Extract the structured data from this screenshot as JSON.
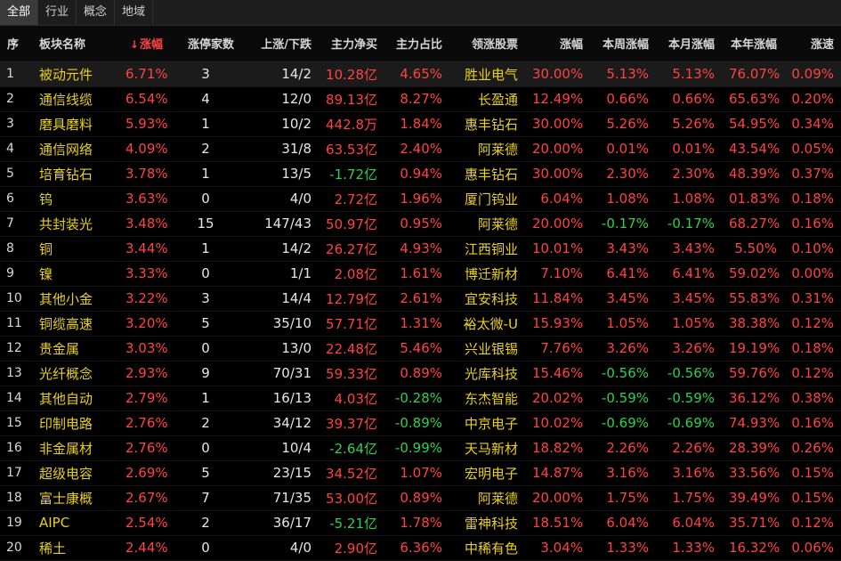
{
  "tabs": [
    "全部",
    "行业",
    "概念",
    "地域"
  ],
  "columns": {
    "idx": "序",
    "name": "板块名称",
    "sort_mark": "↓",
    "change": "涨幅",
    "limit_up": "涨停家数",
    "up_down": "上涨/下跌",
    "net_inflow": "主力净买",
    "ratio": "主力占比",
    "leader": "领涨股票",
    "leader_change": "涨幅",
    "week": "本周涨幅",
    "month": "本月涨幅",
    "year": "本年涨幅",
    "speed": "涨速"
  },
  "rows": [
    {
      "idx": "1",
      "name": "被动元件",
      "change": "6.71%",
      "limit_up": "3",
      "up_down": "14/2",
      "net": "10.28亿",
      "ratio": "4.65%",
      "leader": "胜业电气",
      "lchg": "30.00%",
      "week": "5.13%",
      "month": "5.13%",
      "year": "76.07%",
      "speed": "0.09%"
    },
    {
      "idx": "2",
      "name": "通信线缆",
      "change": "6.54%",
      "limit_up": "4",
      "up_down": "12/0",
      "net": "89.13亿",
      "ratio": "8.27%",
      "leader": "长盈通",
      "lchg": "12.49%",
      "week": "0.66%",
      "month": "0.66%",
      "year": "65.63%",
      "speed": "0.20%"
    },
    {
      "idx": "3",
      "name": "磨具磨料",
      "change": "5.93%",
      "limit_up": "1",
      "up_down": "10/2",
      "net": "442.8万",
      "ratio": "1.84%",
      "leader": "惠丰钻石",
      "lchg": "30.00%",
      "week": "5.26%",
      "month": "5.26%",
      "year": "54.95%",
      "speed": "0.34%"
    },
    {
      "idx": "4",
      "name": "通信网络",
      "change": "4.09%",
      "limit_up": "2",
      "up_down": "31/8",
      "net": "63.53亿",
      "ratio": "2.40%",
      "leader": "阿莱德",
      "lchg": "20.00%",
      "week": "0.01%",
      "month": "0.01%",
      "year": "43.54%",
      "speed": "0.05%"
    },
    {
      "idx": "5",
      "name": "培育钻石",
      "change": "3.78%",
      "limit_up": "1",
      "up_down": "13/5",
      "net": "-1.72亿",
      "ratio": "0.94%",
      "leader": "惠丰钻石",
      "lchg": "30.00%",
      "week": "2.30%",
      "month": "2.30%",
      "year": "48.39%",
      "speed": "0.37%"
    },
    {
      "idx": "6",
      "name": "钨",
      "change": "3.63%",
      "limit_up": "0",
      "up_down": "4/0",
      "net": "2.72亿",
      "ratio": "1.96%",
      "leader": "厦门钨业",
      "lchg": "6.04%",
      "week": "1.08%",
      "month": "1.08%",
      "year": "01.83%",
      "speed": "0.18%"
    },
    {
      "idx": "7",
      "name": "共封装光",
      "change": "3.48%",
      "limit_up": "15",
      "up_down": "147/43",
      "net": "50.97亿",
      "ratio": "0.95%",
      "leader": "阿莱德",
      "lchg": "20.00%",
      "week": "-0.17%",
      "month": "-0.17%",
      "year": "68.27%",
      "speed": "0.16%"
    },
    {
      "idx": "8",
      "name": "铜",
      "change": "3.44%",
      "limit_up": "1",
      "up_down": "14/2",
      "net": "26.27亿",
      "ratio": "4.93%",
      "leader": "江西铜业",
      "lchg": "10.01%",
      "week": "3.43%",
      "month": "3.43%",
      "year": "5.50%",
      "speed": "0.10%"
    },
    {
      "idx": "9",
      "name": "镍",
      "change": "3.33%",
      "limit_up": "0",
      "up_down": "1/1",
      "net": "2.08亿",
      "ratio": "1.61%",
      "leader": "博迁新材",
      "lchg": "7.10%",
      "week": "6.41%",
      "month": "6.41%",
      "year": "59.02%",
      "speed": "0.00%"
    },
    {
      "idx": "10",
      "name": "其他小金",
      "change": "3.22%",
      "limit_up": "3",
      "up_down": "14/4",
      "net": "12.79亿",
      "ratio": "2.61%",
      "leader": "宜安科技",
      "lchg": "11.84%",
      "week": "3.45%",
      "month": "3.45%",
      "year": "55.83%",
      "speed": "0.31%"
    },
    {
      "idx": "11",
      "name": "铜缆高速",
      "change": "3.20%",
      "limit_up": "5",
      "up_down": "35/10",
      "net": "57.71亿",
      "ratio": "1.31%",
      "leader": "裕太微-U",
      "lchg": "15.93%",
      "week": "1.05%",
      "month": "1.05%",
      "year": "38.38%",
      "speed": "0.12%"
    },
    {
      "idx": "12",
      "name": "贵金属",
      "change": "3.03%",
      "limit_up": "0",
      "up_down": "13/0",
      "net": "22.48亿",
      "ratio": "5.46%",
      "leader": "兴业银锡",
      "lchg": "7.76%",
      "week": "3.26%",
      "month": "3.26%",
      "year": "19.19%",
      "speed": "0.18%"
    },
    {
      "idx": "13",
      "name": "光纤概念",
      "change": "2.93%",
      "limit_up": "9",
      "up_down": "70/31",
      "net": "59.33亿",
      "ratio": "0.89%",
      "leader": "光库科技",
      "lchg": "15.46%",
      "week": "-0.56%",
      "month": "-0.56%",
      "year": "59.76%",
      "speed": "0.12%"
    },
    {
      "idx": "14",
      "name": "其他自动",
      "change": "2.79%",
      "limit_up": "1",
      "up_down": "16/13",
      "net": "4.03亿",
      "ratio": "-0.28%",
      "leader": "东杰智能",
      "lchg": "20.02%",
      "week": "-0.59%",
      "month": "-0.59%",
      "year": "36.12%",
      "speed": "0.38%"
    },
    {
      "idx": "15",
      "name": "印制电路",
      "change": "2.76%",
      "limit_up": "2",
      "up_down": "34/12",
      "net": "39.37亿",
      "ratio": "-0.89%",
      "leader": "中京电子",
      "lchg": "10.02%",
      "week": "-0.69%",
      "month": "-0.69%",
      "year": "74.93%",
      "speed": "0.16%"
    },
    {
      "idx": "16",
      "name": "非金属材",
      "change": "2.76%",
      "limit_up": "0",
      "up_down": "10/4",
      "net": "-2.64亿",
      "ratio": "-0.99%",
      "leader": "天马新材",
      "lchg": "18.82%",
      "week": "2.26%",
      "month": "2.26%",
      "year": "28.39%",
      "speed": "0.26%"
    },
    {
      "idx": "17",
      "name": "超级电容",
      "change": "2.69%",
      "limit_up": "5",
      "up_down": "23/15",
      "net": "34.52亿",
      "ratio": "1.07%",
      "leader": "宏明电子",
      "lchg": "14.87%",
      "week": "3.16%",
      "month": "3.16%",
      "year": "33.56%",
      "speed": "0.15%"
    },
    {
      "idx": "18",
      "name": "富士康概",
      "change": "2.67%",
      "limit_up": "7",
      "up_down": "71/35",
      "net": "53.00亿",
      "ratio": "0.89%",
      "leader": "阿莱德",
      "lchg": "20.00%",
      "week": "1.75%",
      "month": "1.75%",
      "year": "39.49%",
      "speed": "0.15%"
    },
    {
      "idx": "19",
      "name": "AIPC",
      "change": "2.54%",
      "limit_up": "2",
      "up_down": "36/17",
      "net": "-5.21亿",
      "ratio": "1.78%",
      "leader": "雷神科技",
      "lchg": "18.51%",
      "week": "6.04%",
      "month": "6.04%",
      "year": "35.71%",
      "speed": "0.12%"
    },
    {
      "idx": "20",
      "name": "稀土",
      "change": "2.44%",
      "limit_up": "0",
      "up_down": "4/0",
      "net": "2.90亿",
      "ratio": "6.36%",
      "leader": "中稀有色",
      "lchg": "3.04%",
      "week": "1.33%",
      "month": "1.33%",
      "year": "16.32%",
      "speed": "0.06%"
    }
  ],
  "colors": {
    "up": "#ff4242",
    "down": "#2fd04a",
    "name": "#e8d020",
    "neutral": "#e6e6e6"
  }
}
